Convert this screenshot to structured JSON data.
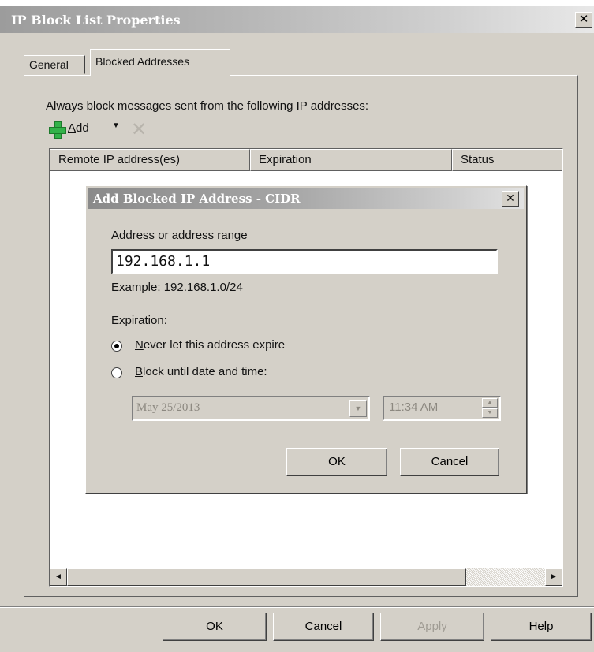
{
  "window": {
    "title": "IP Block List Properties",
    "close_glyph": "✕"
  },
  "tabs": [
    {
      "label": "General",
      "active": false
    },
    {
      "label": "Blocked Addresses",
      "active": true
    }
  ],
  "blocked": {
    "description": "Always block messages sent from the following IP addresses:",
    "add_label": "Add",
    "add_underline": "A",
    "add_rest": "dd",
    "dropdown_glyph": "▼",
    "remove_glyph": "✕",
    "columns": [
      "Remote IP address(es)",
      "Expiration",
      "Status"
    ],
    "scroll_left": "◄",
    "scroll_right": "►"
  },
  "dialog": {
    "title": "Add Blocked IP Address - CIDR",
    "close_glyph": "✕",
    "address_label_u": "A",
    "address_label_rest": "ddress or address range",
    "address_value": "192.168.1.1",
    "example": "Example: 192.168.1.0/24",
    "expiration_label": "Expiration:",
    "radio_never_u": "N",
    "radio_never_rest": "ever let this address expire",
    "radio_never_selected": true,
    "radio_until_u": "B",
    "radio_until_rest": "lock until date and time:",
    "radio_until_selected": false,
    "date_value": "May 25/2013",
    "time_value": "11:34 AM",
    "ok": "OK",
    "cancel": "Cancel"
  },
  "footer": {
    "ok": "OK",
    "cancel": "Cancel",
    "apply": "Apply",
    "help": "Help"
  },
  "colors": {
    "face": "#d4d0c8",
    "plus_icon": "#33b24a",
    "disabled_text": "#a09c94"
  }
}
